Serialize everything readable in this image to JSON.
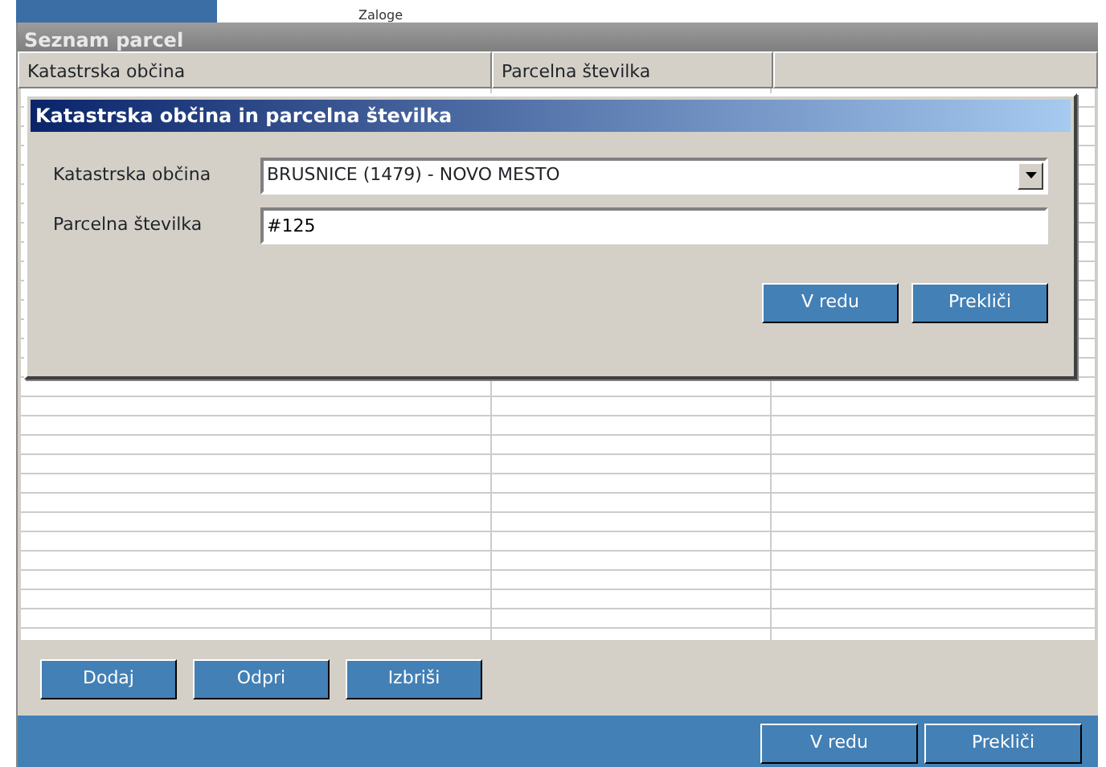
{
  "background": {
    "label": "Zaloge"
  },
  "window": {
    "title": "Seznam parcel"
  },
  "table": {
    "columns": [
      "Katastrska občina",
      "Parcelna številka"
    ]
  },
  "dialog": {
    "title": "Katastrska občina in parcelna številka",
    "fields": [
      {
        "kind": "dropdown",
        "label": "Katastrska občina",
        "value": "BRUSNICE (1479) - NOVO MESTO"
      },
      {
        "kind": "text",
        "label": "Parcelna številka",
        "value": "#125"
      }
    ],
    "buttons": [
      "V redu",
      "Prekliči"
    ]
  },
  "actions": [
    "Dodaj",
    "Odpri",
    "Izbriši"
  ],
  "footer_buttons": [
    "V redu",
    "Prekliči"
  ]
}
